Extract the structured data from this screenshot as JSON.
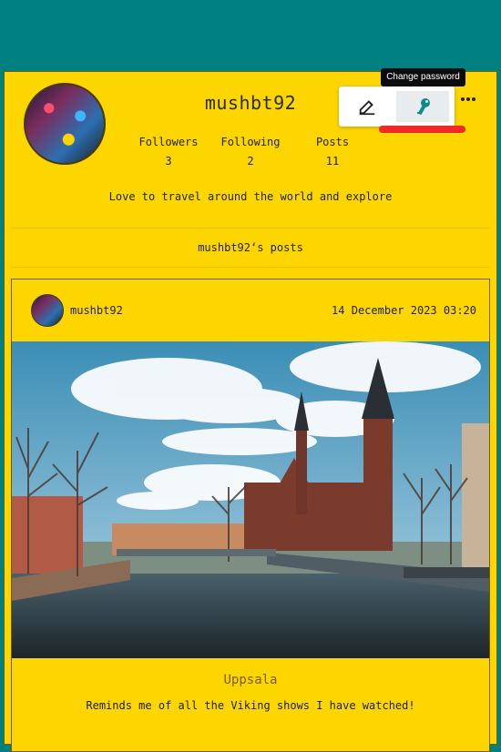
{
  "profile": {
    "username": "mushbt92",
    "followers_label": "Followers",
    "followers_count": "3",
    "following_label": "Following",
    "following_count": "2",
    "posts_label": "Posts",
    "posts_count": "11",
    "bio": "Love to travel around the world and explore",
    "posts_heading": "mushbt92‘s posts"
  },
  "actions": {
    "tooltip": "Change password",
    "edit_icon": "edit-icon",
    "key_icon": "key-icon",
    "more_icon": "more-icon"
  },
  "post": {
    "author": "mushbt92",
    "date": "14 December 2023 03:20",
    "title": "Uppsala",
    "text": "Reminds me of all the Viking shows I have watched!"
  },
  "colors": {
    "background": "#008080",
    "card": "#fdd600",
    "highlight": "#f02828",
    "key": "#0f8b8d"
  }
}
